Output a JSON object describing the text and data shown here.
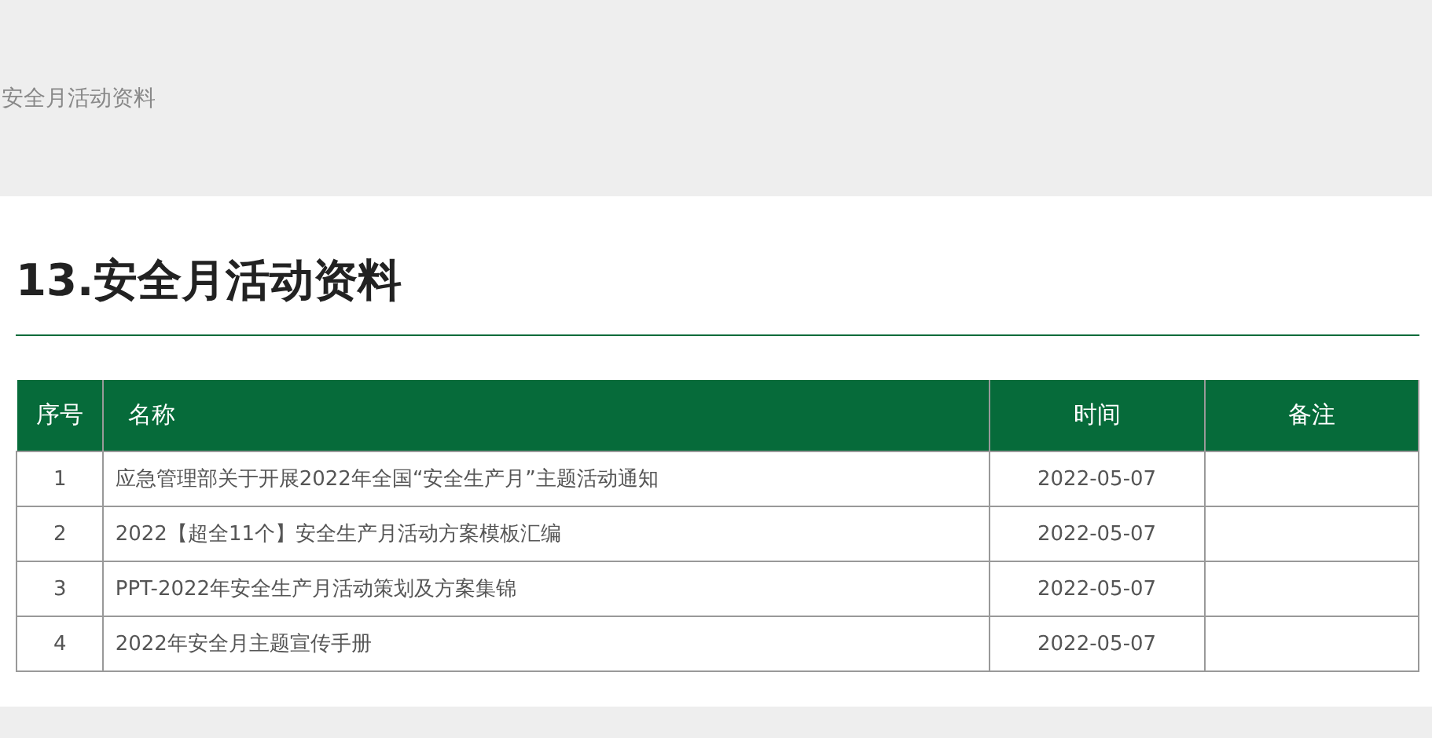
{
  "breadcrumb": "安全月活动资料",
  "heading": "13.安全月活动资料",
  "table": {
    "columns": [
      "序号",
      "名称",
      "时间",
      "备注"
    ],
    "rows": [
      {
        "index": "1",
        "name": "应急管理部关于开展2022年全国“安全生产月”主题活动通知",
        "date": "2022-05-07"
      },
      {
        "index": "2",
        "name": "2022【超全11个】安全生产月活动方案模板汇编",
        "date": "2022-05-07"
      },
      {
        "index": "3",
        "name": "PPT-2022年安全生产月活动策划及方案集锦",
        "date": "2022-05-07"
      },
      {
        "index": "4",
        "name": "2022年安全月主题宣传手册",
        "date": "2022-05-07"
      }
    ]
  }
}
